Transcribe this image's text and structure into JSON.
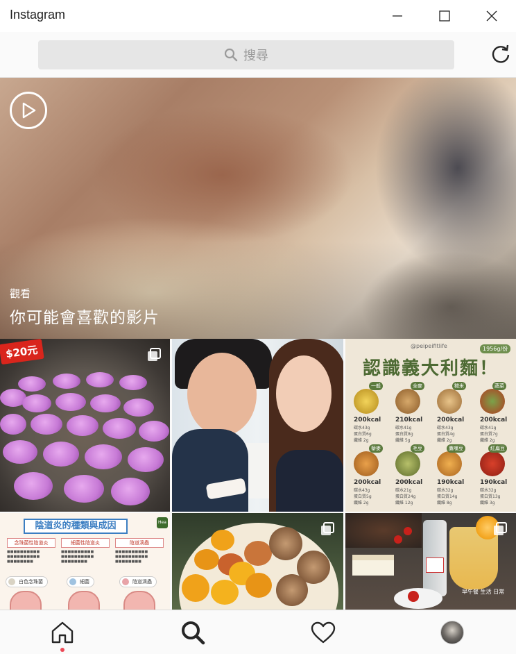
{
  "window": {
    "title": "Instagram",
    "minimize_icon": "minimize-icon",
    "maximize_icon": "maximize-icon",
    "close_icon": "close-icon"
  },
  "search": {
    "placeholder": "搜尋",
    "icon": "search-icon",
    "refresh_icon": "refresh-icon"
  },
  "hero": {
    "play_icon": "play-icon",
    "subtitle": "觀看",
    "title": "你可能會喜歡的影片"
  },
  "grid": {
    "tile1": {
      "price_tag": "$20元",
      "multi_icon": "multiple-photos-icon"
    },
    "tile3": {
      "handle": "@peipeifitlife",
      "tag": "1956g/份",
      "heading": "認識義大利麵！",
      "items": [
        {
          "name": "一般",
          "kcal": "200kcal",
          "nutrients": [
            "碳水43g",
            "蛋白質6g",
            "纖維 2g"
          ]
        },
        {
          "name": "全麥",
          "kcal": "210kcal",
          "nutrients": [
            "碳水41g",
            "蛋白質8g",
            "纖維 5g"
          ]
        },
        {
          "name": "糙米",
          "kcal": "200kcal",
          "nutrients": [
            "碳水43g",
            "蛋白質4g",
            "纖維 2g"
          ]
        },
        {
          "name": "蔬菜",
          "kcal": "200kcal",
          "nutrients": [
            "碳水41g",
            "蛋白質7g",
            "纖維 2g"
          ]
        },
        {
          "name": "藜麥",
          "kcal": "200kcal",
          "nutrients": [
            "碳水43g",
            "蛋白質5g",
            "纖維 2g"
          ]
        },
        {
          "name": "毛豆",
          "kcal": "200kcal",
          "nutrients": [
            "碳水21g",
            "蛋白質24g",
            "纖維 12g"
          ]
        },
        {
          "name": "鷹嘴豆",
          "kcal": "190kcal",
          "nutrients": [
            "碳水32g",
            "蛋白質14g",
            "纖維 8g"
          ]
        },
        {
          "name": "紅扁豆",
          "kcal": "190kcal",
          "nutrients": [
            "碳水32g",
            "蛋白質13g",
            "纖維 3g"
          ]
        }
      ]
    },
    "tile4": {
      "banner": "陰道炎的種類與成因",
      "columns": [
        "念珠菌性陰道炎",
        "細菌性陰道炎",
        "陰道滴蟲"
      ],
      "pills": [
        "白色念珠菌",
        "細菌",
        "陰道滴蟲"
      ]
    },
    "tile6": {
      "caption": "早午餐 生活 日常"
    }
  },
  "nav": {
    "home_icon": "home-icon",
    "search_icon": "search-icon",
    "heart_icon": "heart-icon",
    "profile_icon": "avatar"
  },
  "colors": {
    "notification_dot": "#ed4956",
    "accent_green": "#4d6a33"
  }
}
